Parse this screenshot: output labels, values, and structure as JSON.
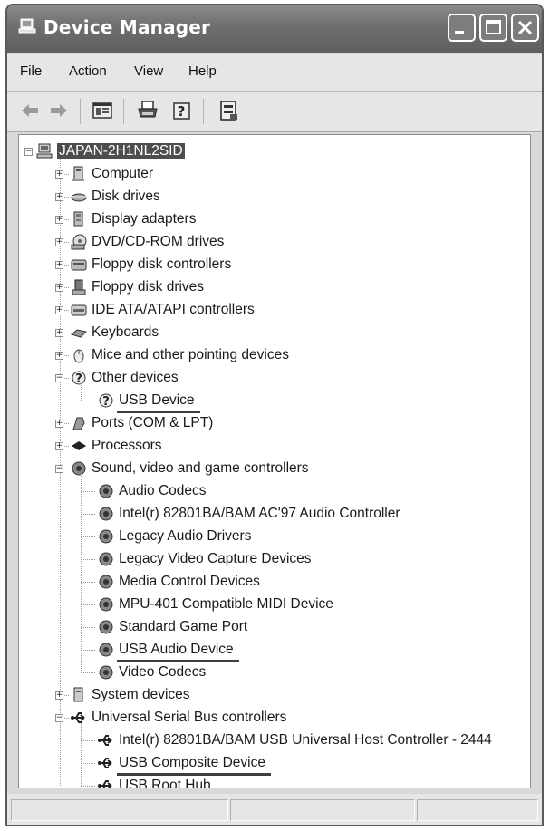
{
  "window": {
    "title": "Device Manager"
  },
  "menu": [
    "File",
    "Action",
    "View",
    "Help"
  ],
  "tree": {
    "root": "JAPAN-2H1NL2SID",
    "categories": [
      {
        "label": "Computer",
        "icon": "computer-icon",
        "expanded": false
      },
      {
        "label": "Disk drives",
        "icon": "disk-drive-icon",
        "expanded": false
      },
      {
        "label": "Display adapters",
        "icon": "display-adapter-icon",
        "expanded": false
      },
      {
        "label": "DVD/CD-ROM drives",
        "icon": "dvd-drive-icon",
        "expanded": false
      },
      {
        "label": "Floppy disk controllers",
        "icon": "floppy-controller-icon",
        "expanded": false
      },
      {
        "label": "Floppy disk drives",
        "icon": "floppy-drive-icon",
        "expanded": false
      },
      {
        "label": "IDE ATA/ATAPI controllers",
        "icon": "ide-controller-icon",
        "expanded": false
      },
      {
        "label": "Keyboards",
        "icon": "keyboard-icon",
        "expanded": false
      },
      {
        "label": "Mice and other pointing devices",
        "icon": "mouse-icon",
        "expanded": false
      },
      {
        "label": "Other devices",
        "icon": "unknown-device-icon",
        "expanded": true,
        "children": [
          {
            "label": "USB Device",
            "icon": "unknown-device-icon",
            "underlined": true
          }
        ]
      },
      {
        "label": "Ports (COM & LPT)",
        "icon": "port-icon",
        "expanded": false
      },
      {
        "label": "Processors",
        "icon": "processor-icon",
        "expanded": false
      },
      {
        "label": "Sound, video and game controllers",
        "icon": "sound-icon",
        "expanded": true,
        "children": [
          {
            "label": "Audio Codecs",
            "icon": "sound-icon"
          },
          {
            "label": "Intel(r) 82801BA/BAM AC'97 Audio Controller",
            "icon": "sound-icon"
          },
          {
            "label": "Legacy Audio Drivers",
            "icon": "sound-icon"
          },
          {
            "label": "Legacy Video Capture Devices",
            "icon": "sound-icon"
          },
          {
            "label": "Media Control Devices",
            "icon": "sound-icon"
          },
          {
            "label": "MPU-401 Compatible MIDI Device",
            "icon": "sound-icon"
          },
          {
            "label": "Standard Game Port",
            "icon": "sound-icon"
          },
          {
            "label": "USB Audio Device",
            "icon": "sound-icon",
            "underlined": true
          },
          {
            "label": "Video Codecs",
            "icon": "sound-icon"
          }
        ]
      },
      {
        "label": "System devices",
        "icon": "system-device-icon",
        "expanded": false
      },
      {
        "label": "Universal Serial Bus controllers",
        "icon": "usb-icon",
        "expanded": true,
        "children": [
          {
            "label": "Intel(r) 82801BA/BAM USB Universal Host Controller - 2444",
            "icon": "usb-icon"
          },
          {
            "label": "USB Composite Device",
            "icon": "usb-icon",
            "underlined": true
          },
          {
            "label": "USB Root Hub",
            "icon": "usb-icon"
          }
        ]
      }
    ]
  }
}
